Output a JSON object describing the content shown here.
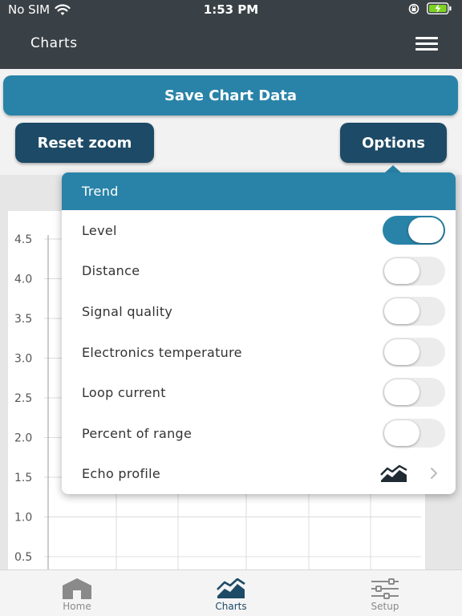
{
  "status_bar": {
    "carrier": "No SIM",
    "time": "1:53 PM"
  },
  "nav": {
    "title": "Charts"
  },
  "buttons": {
    "save": "Save Chart Data",
    "reset_zoom": "Reset zoom",
    "options": "Options"
  },
  "chart_data": {
    "type": "line",
    "y_ticks": [
      "4.5",
      "4.0",
      "3.5",
      "3.0",
      "2.5",
      "2.0",
      "1.5",
      "1.0",
      "0.5"
    ],
    "grid": true
  },
  "popover": {
    "header": "Trend",
    "items": [
      {
        "label": "Level",
        "on": true
      },
      {
        "label": "Distance",
        "on": false
      },
      {
        "label": "Signal quality",
        "on": false
      },
      {
        "label": "Electronics temperature",
        "on": false
      },
      {
        "label": "Loop current",
        "on": false
      },
      {
        "label": "Percent of range",
        "on": false
      }
    ],
    "echo_profile": "Echo profile"
  },
  "tabs": [
    {
      "label": "Home",
      "icon": "home-icon",
      "active": false
    },
    {
      "label": "Charts",
      "icon": "charts-icon",
      "active": true
    },
    {
      "label": "Setup",
      "icon": "sliders-icon",
      "active": false
    }
  ],
  "colors": {
    "accent": "#2983a8",
    "dark": "#1d4a66",
    "bar": "#3a4146",
    "battery": "#7ed321"
  }
}
